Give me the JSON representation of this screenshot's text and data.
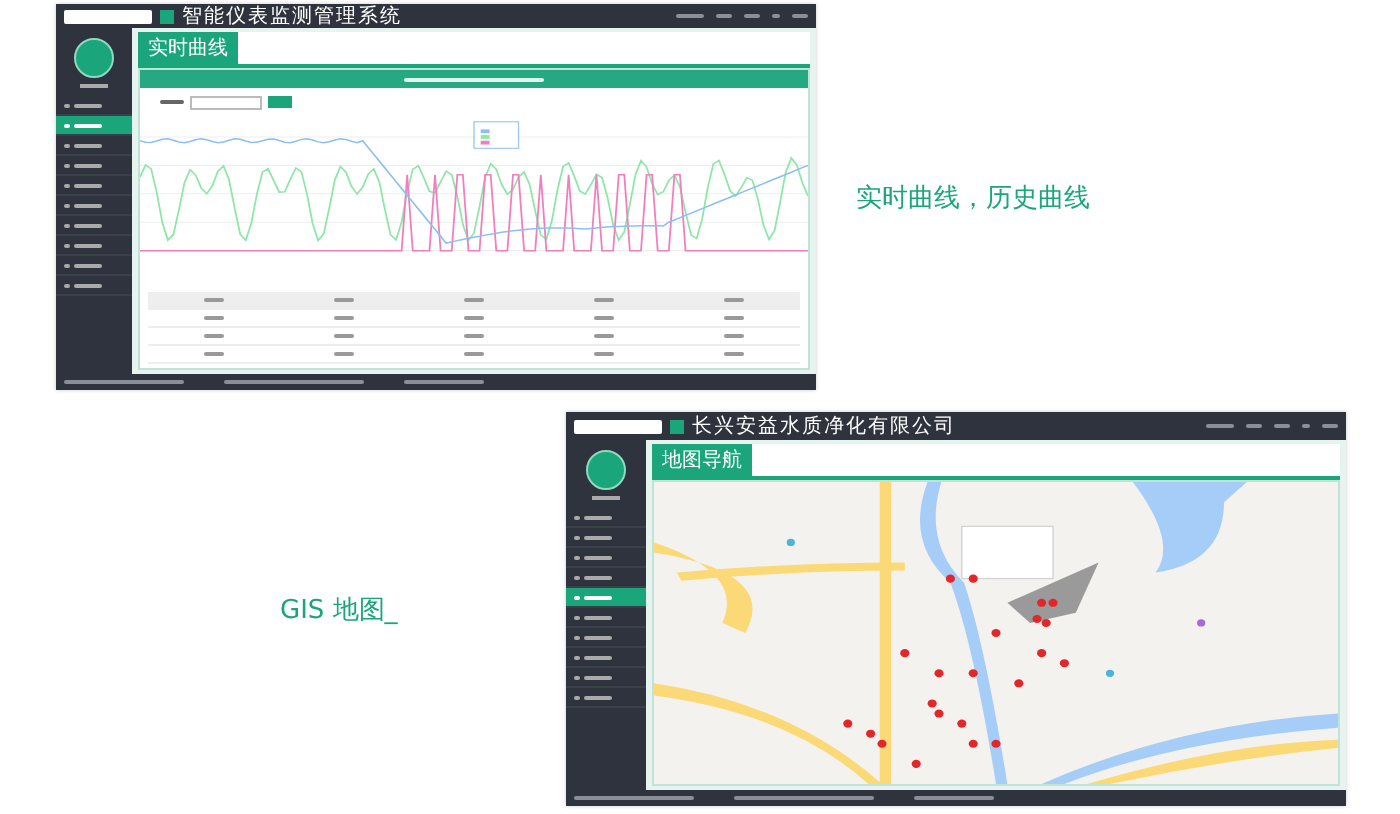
{
  "screens": [
    {
      "title": "智能仪表监测管理系统",
      "tab": "实时曲线",
      "content": {
        "kind": "chart"
      },
      "sidebar_items": [
        {
          "selected": false
        },
        {
          "selected": true
        },
        {
          "selected": false
        },
        {
          "selected": false
        },
        {
          "selected": false
        },
        {
          "selected": false
        },
        {
          "selected": false
        },
        {
          "selected": false
        },
        {
          "selected": false
        },
        {
          "selected": false
        }
      ]
    },
    {
      "title": "长兴安益水质净化有限公司",
      "tab": "地图导航",
      "content": {
        "kind": "map"
      },
      "sidebar_items": [
        {
          "selected": false
        },
        {
          "selected": false
        },
        {
          "selected": false
        },
        {
          "selected": false
        },
        {
          "selected": true
        },
        {
          "selected": false
        },
        {
          "selected": false
        },
        {
          "selected": false
        },
        {
          "selected": false
        },
        {
          "selected": false
        }
      ]
    }
  ],
  "captions": [
    "实时曲线，历史曲线",
    "GIS 地图_"
  ]
}
